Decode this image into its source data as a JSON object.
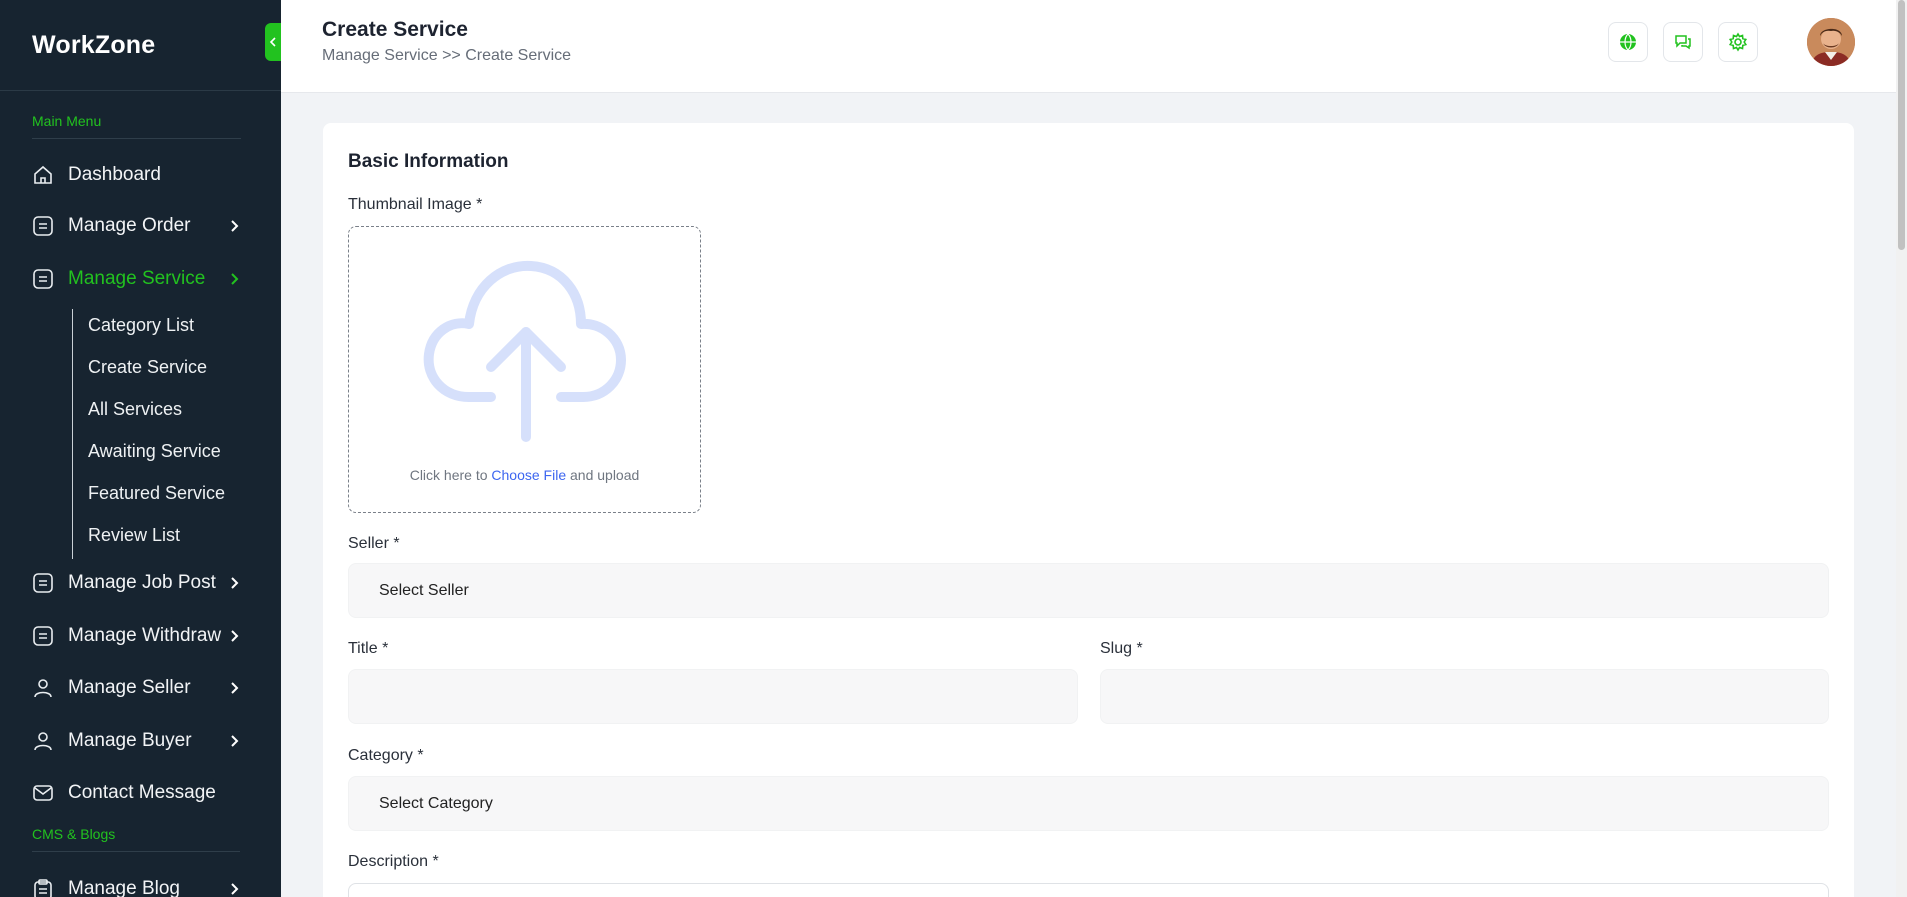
{
  "sidebar": {
    "brand": "WorkZone",
    "section_main": "Main Menu",
    "section_cms": "CMS & Blogs",
    "items": [
      {
        "label": "Dashboard",
        "icon": "home-icon"
      },
      {
        "label": "Manage Order",
        "icon": "list-icon"
      },
      {
        "label": "Manage Service",
        "icon": "list-icon",
        "active": true
      },
      {
        "label": "Manage Job Post",
        "icon": "list-icon"
      },
      {
        "label": "Manage Withdraw",
        "icon": "list-icon"
      },
      {
        "label": "Manage Seller",
        "icon": "user-icon"
      },
      {
        "label": "Manage Buyer",
        "icon": "user-icon"
      },
      {
        "label": "Contact Message",
        "icon": "mail-icon"
      },
      {
        "label": "Manage Blog",
        "icon": "clipboard-icon"
      }
    ],
    "submenu": [
      "Category List",
      "Create Service",
      "All Services",
      "Awaiting Service",
      "Featured Service",
      "Review List"
    ]
  },
  "header": {
    "title": "Create Service",
    "breadcrumb": "Manage Service >> Create Service",
    "icons": [
      "globe-icon",
      "chat-icon",
      "gear-icon"
    ]
  },
  "form": {
    "section_title": "Basic Information",
    "thumbnail_label": "Thumbnail Image *",
    "upload_prefix": "Click here to",
    "upload_link": "Choose File",
    "upload_suffix": "and upload",
    "seller_label": "Seller *",
    "seller_value": "Select Seller",
    "title_label": "Title *",
    "title_value": "",
    "slug_label": "Slug *",
    "slug_value": "",
    "category_label": "Category *",
    "category_value": "Select Category",
    "description_label": "Description *"
  },
  "colors": {
    "accent": "#22c21f",
    "sidebar_bg": "#172430",
    "link": "#3d66f0"
  }
}
